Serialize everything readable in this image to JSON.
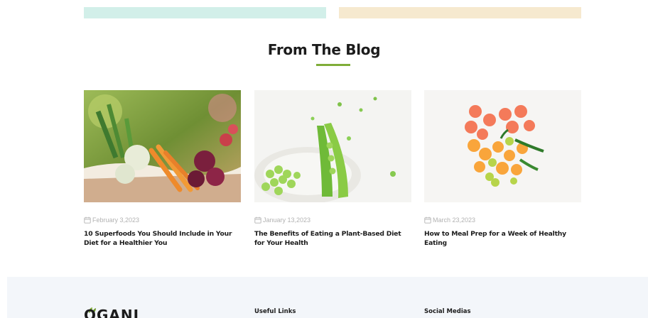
{
  "section": {
    "title": "From The Blog",
    "accent_color": "#7fad39"
  },
  "posts": [
    {
      "date": "February 3,2023",
      "title": "10 Superfoods You Should Include in Your Diet for a Healthier You"
    },
    {
      "date": "January 13,2023",
      "title": "The Benefits of Eating a Plant-Based Diet for Your Health"
    },
    {
      "date": "March 23,2023",
      "title": "How to Meal Prep for a Week of Healthy Eating"
    }
  ],
  "footer": {
    "logo_text": "OGANI",
    "useful_links_heading": "Useful Links",
    "social_medias_heading": "Social Medias"
  },
  "icons": {
    "date": "calendar-icon",
    "logo": "leaf-icon"
  }
}
